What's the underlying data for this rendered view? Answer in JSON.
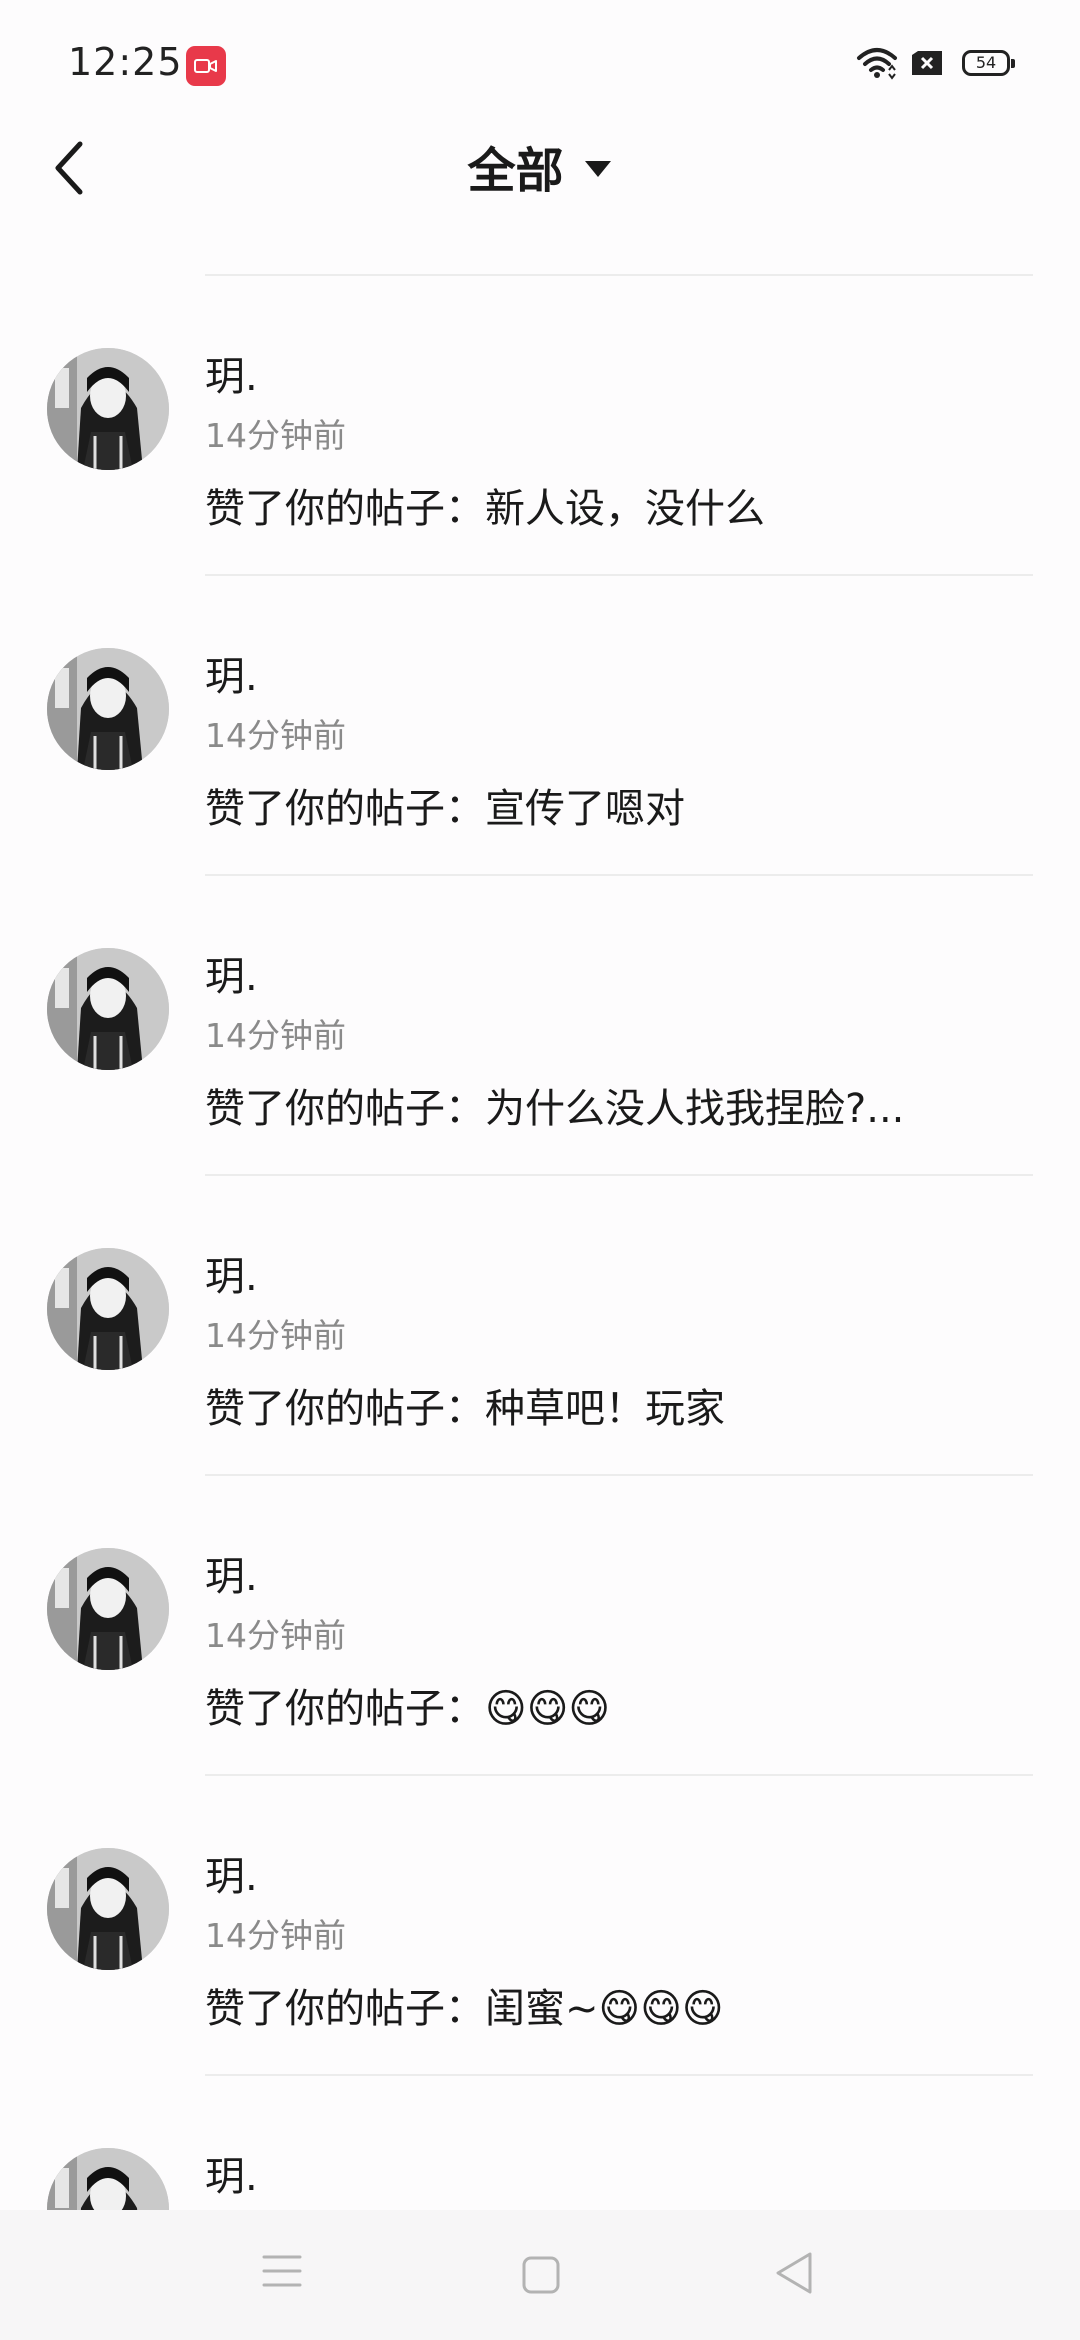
{
  "status_bar": {
    "time": "12:25",
    "battery": "54",
    "recording_color": "#e8394a"
  },
  "header": {
    "title": "全部"
  },
  "notifications": [
    {
      "user": "玥.",
      "time": "14分钟前",
      "message": "赞了你的帖子：新人设，没什么"
    },
    {
      "user": "玥.",
      "time": "14分钟前",
      "message": "赞了你的帖子：宣传了嗯对"
    },
    {
      "user": "玥.",
      "time": "14分钟前",
      "message": "赞了你的帖子：为什么没人找我捏脸?..."
    },
    {
      "user": "玥.",
      "time": "14分钟前",
      "message": "赞了你的帖子：种草吧！玩家"
    },
    {
      "user": "玥.",
      "time": "14分钟前",
      "message": "赞了你的帖子：😋😋😋"
    },
    {
      "user": "玥.",
      "time": "14分钟前",
      "message": "赞了你的帖子：闺蜜~😋😋😋"
    },
    {
      "user": "玥.",
      "time": "",
      "message": ""
    }
  ],
  "icons": {
    "back": "chevron-left-icon",
    "dropdown": "triangle-down-icon",
    "wifi": "wifi-icon",
    "sim": "sim-icon",
    "nav_menu": "menu-icon",
    "nav_home": "square-icon",
    "nav_back": "triangle-left-icon"
  }
}
